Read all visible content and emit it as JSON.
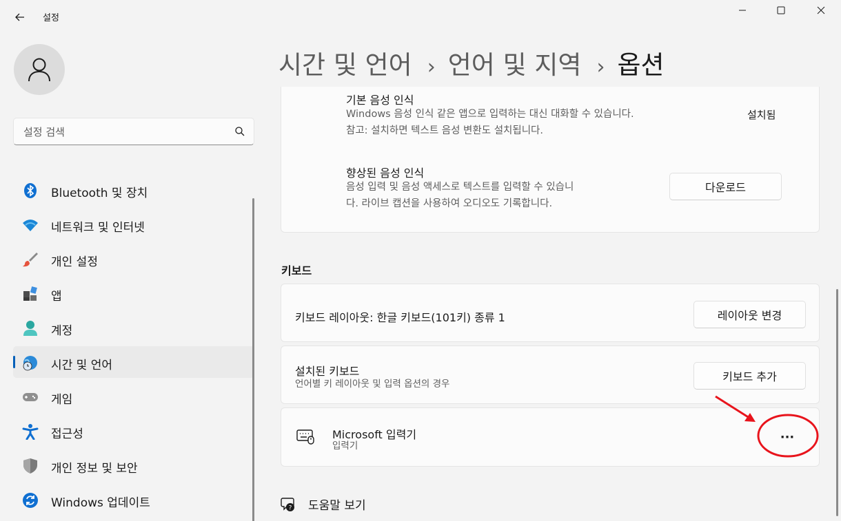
{
  "app": {
    "title": "설정"
  },
  "search": {
    "placeholder": "설정 검색"
  },
  "sidebar": {
    "items": [
      {
        "label": "Bluetooth 및 장치",
        "icon": "bluetooth-icon"
      },
      {
        "label": "네트워크 및 인터넷",
        "icon": "wifi-icon"
      },
      {
        "label": "개인 설정",
        "icon": "paintbrush-icon"
      },
      {
        "label": "앱",
        "icon": "apps-icon"
      },
      {
        "label": "계정",
        "icon": "account-icon"
      },
      {
        "label": "시간 및 언어",
        "icon": "time-language-icon",
        "active": true
      },
      {
        "label": "게임",
        "icon": "gamepad-icon"
      },
      {
        "label": "접근성",
        "icon": "accessibility-icon"
      },
      {
        "label": "개인 정보 및 보안",
        "icon": "shield-icon"
      },
      {
        "label": "Windows 업데이트",
        "icon": "update-icon"
      }
    ]
  },
  "breadcrumb": {
    "level1": "시간 및 언어",
    "level2": "언어 및 지역",
    "current": "옵션",
    "separator": "›"
  },
  "speech": {
    "basic": {
      "title": "기본 음성 인식",
      "desc1": "Windows 음성 인식 같은 앱으로 입력하는 대신 대화할 수 있습니다.",
      "desc2": "참고: 설치하면 텍스트 음성 변환도 설치됩니다.",
      "status": "설치됨"
    },
    "enhanced": {
      "title": "향상된 음성 인식",
      "desc1": "음성 입력 및 음성 액세스로 텍스트를 입력할 수 있습니",
      "desc2": "다. 라이브 캡션을 사용하여 오디오도 기록합니다.",
      "button": "다운로드"
    }
  },
  "keyboard": {
    "section_label": "키보드",
    "layout": {
      "text": "키보드 레이아웃: 한글 키보드(101키) 종류 1",
      "button": "레이아웃 변경"
    },
    "installed": {
      "title": "설치된 키보드",
      "desc": "언어별 키 레이아웃 및 입력 옵션의 경우",
      "button": "키보드 추가"
    },
    "ime": {
      "title": "Microsoft 입력기",
      "subtitle": "입력기",
      "more": "···"
    }
  },
  "help": {
    "label": "도움말 보기"
  },
  "colors": {
    "accent": "#005fb8",
    "annotation": "#e8141c"
  }
}
